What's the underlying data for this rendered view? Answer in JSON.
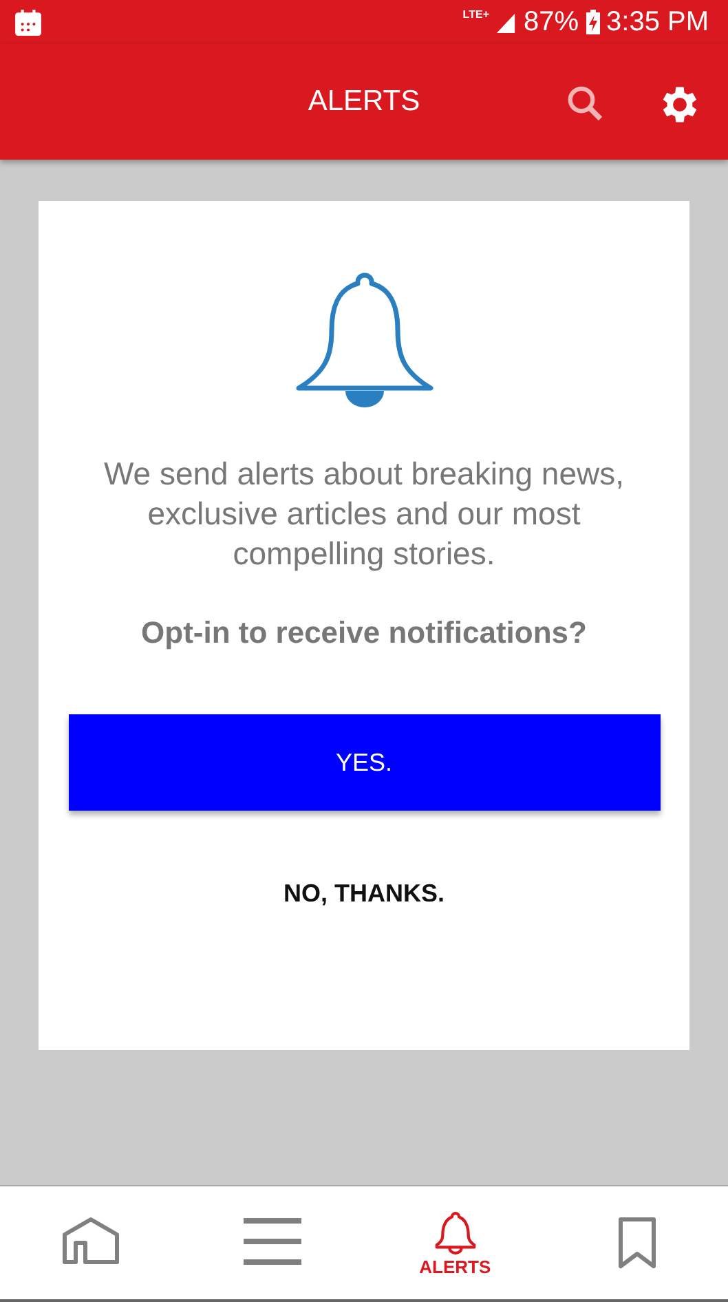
{
  "status_bar": {
    "network": "LTE+",
    "battery": "87%",
    "time": "3:35 PM"
  },
  "app_bar": {
    "title": "ALERTS"
  },
  "card": {
    "message": "We send alerts about breaking news, exclusive articles and our most compelling stories.",
    "question": "Opt-in to receive notifications?",
    "buttons": [
      {
        "kind": "primary",
        "label": "YES."
      },
      {
        "kind": "text",
        "label": "NO, THANKS."
      }
    ]
  },
  "bottom_nav": [
    {
      "kind": "home",
      "selected": false
    },
    {
      "kind": "menu",
      "selected": false
    },
    {
      "kind": "alerts",
      "label": "ALERTS",
      "selected": true
    },
    {
      "kind": "bookmark",
      "selected": false
    }
  ]
}
